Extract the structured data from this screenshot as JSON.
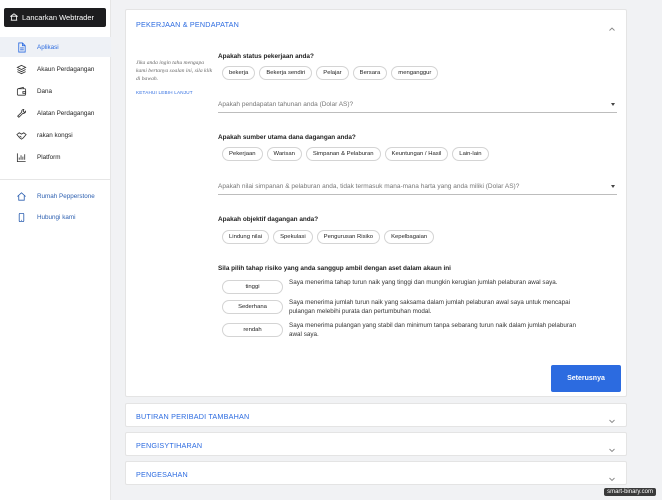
{
  "sidebar": {
    "launch_label": "Lancarkan Webtrader",
    "items": [
      {
        "label": "Aplikasi",
        "icon": "document-icon"
      },
      {
        "label": "Akaun Perdagangan",
        "icon": "layers-icon"
      },
      {
        "label": "Dana",
        "icon": "wallet-icon"
      },
      {
        "label": "Alatan Perdagangan",
        "icon": "wrench-icon"
      },
      {
        "label": "rakan kongsi",
        "icon": "handshake-icon"
      },
      {
        "label": "Platform",
        "icon": "chart-icon"
      }
    ],
    "links": [
      {
        "label": "Rumah Pepperstone",
        "icon": "home-icon"
      },
      {
        "label": "Hubungi kami",
        "icon": "phone-icon"
      }
    ]
  },
  "employment": {
    "title": "PEKERJAAN & PENDAPATAN",
    "why_text": "Jika anda ingin tahu mengapa kami bertanya soalan ini, sila klik di bawah.",
    "learn_more": "KETAHUI LEBIH LANJUT",
    "q_status": "Apakah status pekerjaan anda?",
    "status_options": [
      "bekerja",
      "Bekerja sendiri",
      "Pelajar",
      "Bersara",
      "menganggur"
    ],
    "income_placeholder": "Apakah pendapatan tahunan anda (Dolar AS)?",
    "q_source": "Apakah sumber utama dana dagangan anda?",
    "source_options": [
      "Pekerjaan",
      "Warisan",
      "Simpanan & Pelaburan",
      "Keuntungan / Hasil",
      "Lain-lain"
    ],
    "savings_placeholder": "Apakah nilai simpanan & pelaburan anda, tidak termasuk mana-mana harta yang anda miliki (Dolar AS)?",
    "q_objective": "Apakah objektif dagangan anda?",
    "objective_options": [
      "Lindung nilai",
      "Spekulasi",
      "Pengurusan Risiko",
      "Kepelbagaian"
    ],
    "q_risk": "Sila pilih tahap risiko yang anda sanggup ambil dengan aset dalam akaun ini",
    "risk_options": [
      {
        "label": "tinggi",
        "desc": "Saya menerima tahap turun naik yang tinggi dan mungkin kerugian jumlah pelaburan awal saya."
      },
      {
        "label": "Sederhana",
        "desc": "Saya menerima jumlah turun naik yang saksama dalam jumlah pelaburan awal saya untuk mencapai pulangan melebihi purata dan pertumbuhan modal."
      },
      {
        "label": "rendah",
        "desc": "Saya menerima pulangan yang stabil dan minimum tanpa sebarang turun naik dalam jumlah pelaburan awal saya."
      }
    ],
    "next_label": "Seterusnya"
  },
  "sections": [
    {
      "title": "BUTIRAN PERIBADI TAMBAHAN"
    },
    {
      "title": "PENGISYTIHARAN"
    },
    {
      "title": "PENGESAHAN"
    }
  ],
  "watermark": "smart-binary.com",
  "colors": {
    "accent": "#2c6be0",
    "dark": "#1d1d1f"
  }
}
